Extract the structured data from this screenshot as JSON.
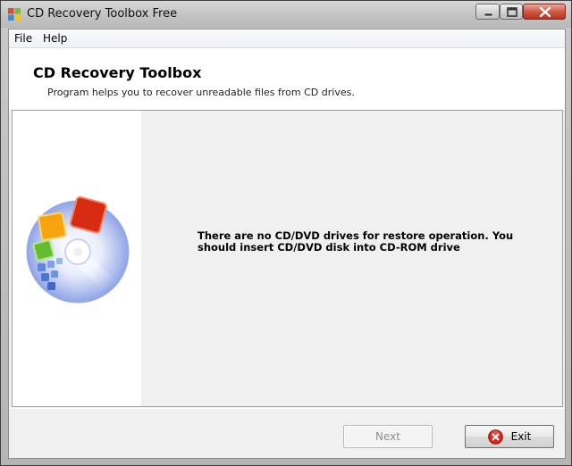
{
  "window": {
    "title": "CD Recovery Toolbox Free",
    "app_icon": "windows-flag-icon",
    "controls": [
      "minimize-icon",
      "maximize-icon",
      "close-icon"
    ]
  },
  "menu": {
    "items": [
      {
        "label": "File"
      },
      {
        "label": "Help"
      }
    ]
  },
  "header": {
    "title": "CD Recovery Toolbox",
    "subtitle": "Program helps you to recover unreadable files from CD drives."
  },
  "main": {
    "logo": "cd-disc-icon",
    "message": "There are no CD/DVD drives for restore operation. You should insert CD/DVD disk into CD-ROM drive"
  },
  "buttons": {
    "next": {
      "label": "Next",
      "enabled": false
    },
    "exit": {
      "label": "Exit",
      "icon": "close-circle-icon"
    }
  },
  "colors": {
    "exit_icon": "#d8261b",
    "disabled_text": "#8d8d8d"
  }
}
